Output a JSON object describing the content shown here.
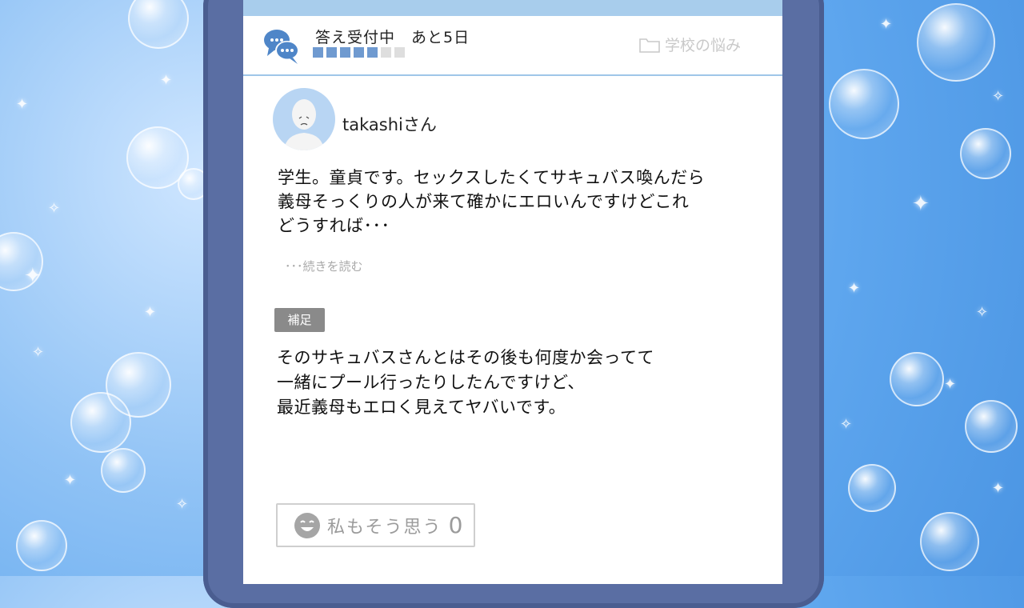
{
  "header": {
    "status": "答え受付中　あと5日",
    "progress": {
      "filled": 5,
      "total": 7
    },
    "category": "学校の悩み"
  },
  "post": {
    "username": "takashiさん",
    "question_lines": [
      "学生。童貞です。セックスしたくてサキュバス喚んだら",
      "義母そっくりの人が来て確かにエロいんですけどこれ",
      "どうすれば･･･"
    ],
    "read_more": "･･･続きを読む",
    "supplement_badge": "補足",
    "supplement_lines": [
      "そのサキュバスさんとはその後も何度か会ってて",
      "一緒にプール行ったりしたんですけど、",
      "最近義母もエロく見えてヤバいです。"
    ]
  },
  "agree_button": {
    "label": "私もそう思う",
    "count": "0"
  },
  "colors": {
    "accent": "#6f9ad0",
    "frame": "#5a6ea3",
    "background": "#6aaef0"
  }
}
